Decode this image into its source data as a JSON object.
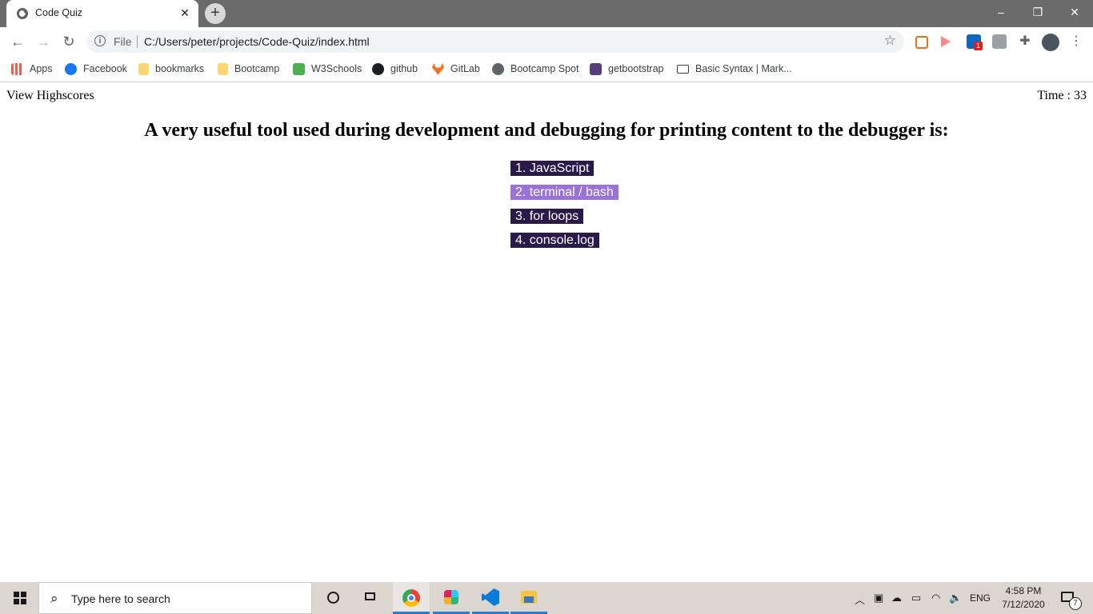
{
  "browser": {
    "tab_title": "Code Quiz",
    "tab_close": "✕",
    "new_tab": "+",
    "window_controls": {
      "minimize": "–",
      "restore": "❐",
      "close": "✕"
    },
    "nav": {
      "back": "←",
      "forward": "→",
      "reload": "↻"
    },
    "address": {
      "scheme_label": "File",
      "url": "C:/Users/peter/projects/Code-Quiz/index.html"
    },
    "bookmarks": [
      {
        "label": "Apps",
        "icon": "apps-grid-icon"
      },
      {
        "label": "Facebook",
        "icon": "facebook-icon"
      },
      {
        "label": "bookmarks",
        "icon": "folder-icon"
      },
      {
        "label": "Bootcamp",
        "icon": "folder-icon"
      },
      {
        "label": "W3Schools",
        "icon": "w3schools-icon"
      },
      {
        "label": "github",
        "icon": "github-icon"
      },
      {
        "label": "GitLab",
        "icon": "gitlab-icon"
      },
      {
        "label": "Bootcamp Spot",
        "icon": "globe-icon"
      },
      {
        "label": "getbootstrap",
        "icon": "bootstrap-icon"
      },
      {
        "label": "Basic Syntax | Mark...",
        "icon": "markdown-icon"
      }
    ],
    "extension_badge": "1"
  },
  "page": {
    "view_highscores": "View Highscores",
    "timer": "Time : 33",
    "question": "A very useful tool used during development and debugging for printing content to the debugger is:",
    "answers": [
      {
        "label": "1. JavaScript",
        "color": "#2a1a4a"
      },
      {
        "label": "2. terminal / bash",
        "color": "#9b72d8"
      },
      {
        "label": "3. for loops",
        "color": "#2a1a4a"
      },
      {
        "label": "4. console.log",
        "color": "#2a1a4a"
      }
    ]
  },
  "taskbar": {
    "search_placeholder": "Type here to search",
    "language": "ENG",
    "time": "4:58 PM",
    "date": "7/12/2020",
    "notification_count": "7"
  }
}
